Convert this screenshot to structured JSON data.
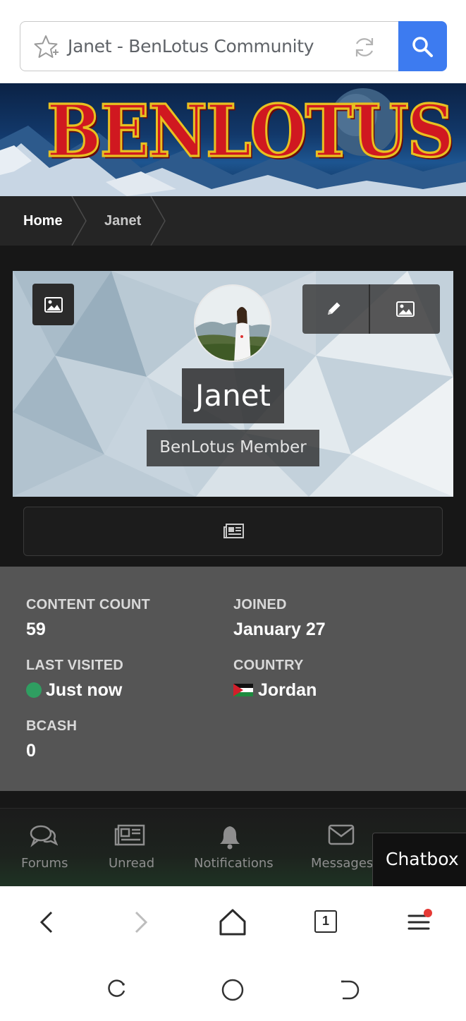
{
  "browser": {
    "url_title": "Janet - BenLotus Community",
    "tab_count": "1"
  },
  "site": {
    "logo_text": "BENLOTUS"
  },
  "breadcrumb": {
    "items": [
      "Home",
      "Janet"
    ]
  },
  "profile": {
    "name": "Janet",
    "rank": "BenLotus Member",
    "stats": {
      "content_count_label": "CONTENT COUNT",
      "content_count": "59",
      "joined_label": "JOINED",
      "joined": "January 27",
      "last_visited_label": "LAST VISITED",
      "last_visited": "Just now",
      "country_label": "COUNTRY",
      "country": "Jordan",
      "bcash_label": "BCASH",
      "bcash": "0"
    }
  },
  "site_nav": {
    "items": [
      {
        "label": "Forums",
        "icon": "chat-bubbles-icon"
      },
      {
        "label": "Unread",
        "icon": "newspaper-icon"
      },
      {
        "label": "Notifications",
        "icon": "bell-icon"
      },
      {
        "label": "Messages",
        "icon": "envelope-icon"
      }
    ],
    "chatbox_label": "Chatbox"
  },
  "colors": {
    "search_button": "#3d7bf0",
    "online_status": "#2f9e61",
    "menu_badge": "#e53935"
  }
}
